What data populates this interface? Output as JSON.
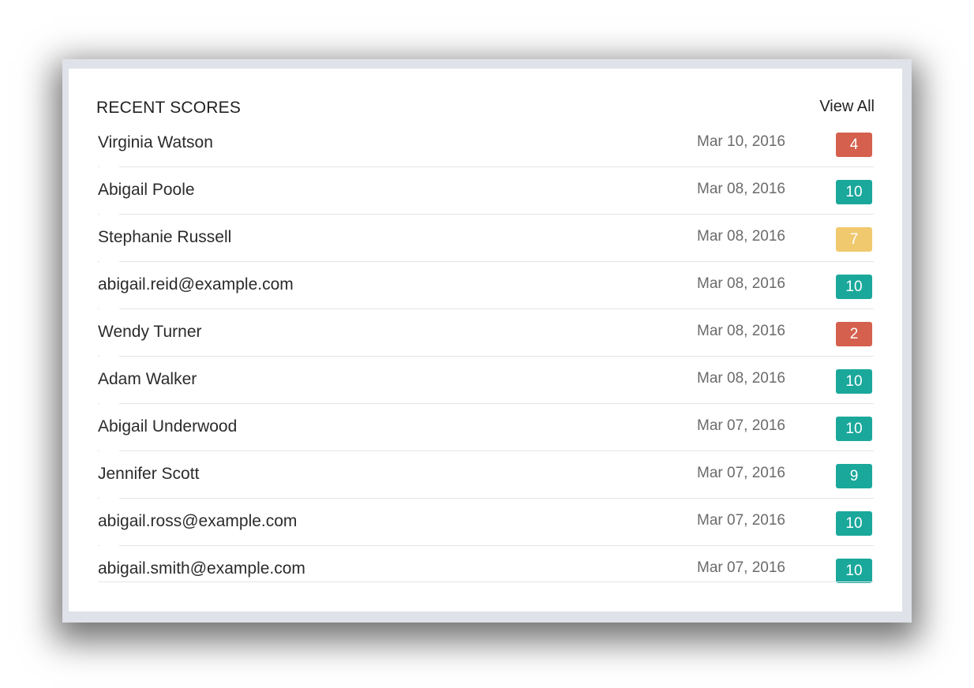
{
  "widget": {
    "title": "RECENT SCORES",
    "view_all_label": "View All"
  },
  "colors": {
    "low": "#d4604d",
    "medium": "#f0c96e",
    "high": "#1aa89b"
  },
  "scores": [
    {
      "name": "Virginia Watson",
      "date": "Mar 10, 2016",
      "score": "4",
      "level": "low"
    },
    {
      "name": "Abigail Poole",
      "date": "Mar 08, 2016",
      "score": "10",
      "level": "high"
    },
    {
      "name": "Stephanie Russell",
      "date": "Mar 08, 2016",
      "score": "7",
      "level": "medium"
    },
    {
      "name": "abigail.reid@example.com",
      "date": "Mar 08, 2016",
      "score": "10",
      "level": "high"
    },
    {
      "name": "Wendy Turner",
      "date": "Mar 08, 2016",
      "score": "2",
      "level": "low"
    },
    {
      "name": "Adam Walker",
      "date": "Mar 08, 2016",
      "score": "10",
      "level": "high"
    },
    {
      "name": "Abigail Underwood",
      "date": "Mar 07, 2016",
      "score": "10",
      "level": "high"
    },
    {
      "name": "Jennifer Scott",
      "date": "Mar 07, 2016",
      "score": "9",
      "level": "high"
    },
    {
      "name": "abigail.ross@example.com",
      "date": "Mar 07, 2016",
      "score": "10",
      "level": "high"
    },
    {
      "name": "abigail.smith@example.com",
      "date": "Mar 07, 2016",
      "score": "10",
      "level": "high"
    }
  ]
}
